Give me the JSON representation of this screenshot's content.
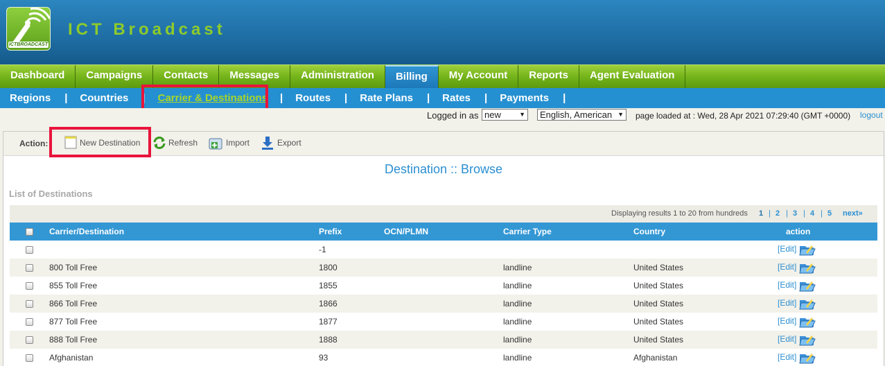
{
  "brand": {
    "name": "ICT Broadcast",
    "logo_text": "ICTBROADCAST"
  },
  "main_nav": [
    {
      "label": "Dashboard",
      "active": false
    },
    {
      "label": "Campaigns",
      "active": false
    },
    {
      "label": "Contacts",
      "active": false
    },
    {
      "label": "Messages",
      "active": false
    },
    {
      "label": "Administration",
      "active": false
    },
    {
      "label": "Billing",
      "active": true
    },
    {
      "label": "My Account",
      "active": false
    },
    {
      "label": "Reports",
      "active": false
    },
    {
      "label": "Agent Evaluation",
      "active": false
    }
  ],
  "sub_nav": [
    {
      "label": "Regions"
    },
    {
      "label": "Countries"
    },
    {
      "label": "Carrier & Destinations",
      "active": true
    },
    {
      "label": "Routes"
    },
    {
      "label": "Rate Plans"
    },
    {
      "label": "Rates"
    },
    {
      "label": "Payments"
    }
  ],
  "sub_nav_separator": "|",
  "login_bar": {
    "logged_in_label": "Logged in as :",
    "user_value": "new",
    "language_value": "English, American",
    "page_loaded": "page loaded at : Wed, 28 Apr 2021 07:29:40 (GMT +0000)",
    "logout": "logout"
  },
  "actions": {
    "label": "Action:",
    "new_destination": "New Destination",
    "refresh": "Refresh",
    "import": "Import",
    "export": "Export"
  },
  "page_title": "Destination :: Browse",
  "list_title": "List of Destinations",
  "pager": {
    "display_text": "Displaying results 1 to 20 from hundreds",
    "pages": [
      "1",
      "2",
      "3",
      "4",
      "5"
    ],
    "next": "next»"
  },
  "table": {
    "columns": [
      "Carrier/Destination",
      "Prefix",
      "OCN/PLMN",
      "Carrier Type",
      "Country",
      "action"
    ],
    "edit_label": "[Edit]",
    "rows": [
      {
        "name": "",
        "prefix": "-1",
        "ocn": "",
        "type": "",
        "country": ""
      },
      {
        "name": "800 Toll Free",
        "prefix": "1800",
        "ocn": "",
        "type": "landline",
        "country": "United States"
      },
      {
        "name": "855 Toll Free",
        "prefix": "1855",
        "ocn": "",
        "type": "landline",
        "country": "United States"
      },
      {
        "name": "866 Toll Free",
        "prefix": "1866",
        "ocn": "",
        "type": "landline",
        "country": "United States"
      },
      {
        "name": "877 Toll Free",
        "prefix": "1877",
        "ocn": "",
        "type": "landline",
        "country": "United States"
      },
      {
        "name": "888 Toll Free",
        "prefix": "1888",
        "ocn": "",
        "type": "landline",
        "country": "United States"
      },
      {
        "name": "Afghanistan",
        "prefix": "93",
        "ocn": "",
        "type": "landline",
        "country": "Afghanistan"
      }
    ]
  }
}
